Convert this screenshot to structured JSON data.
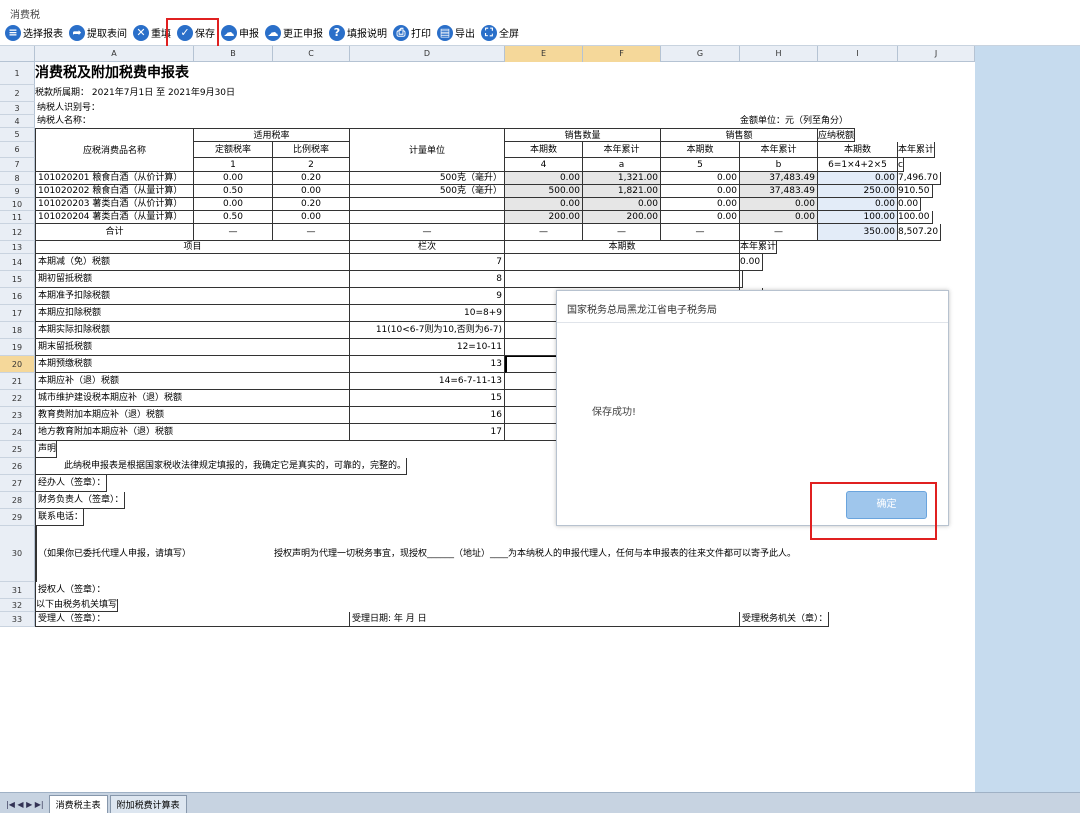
{
  "window": {
    "title": "消费税"
  },
  "toolbar": {
    "items": [
      {
        "label": "选择报表",
        "icon": "list-icon"
      },
      {
        "label": "提取表间",
        "icon": "arrow-icon"
      },
      {
        "label": "重填",
        "icon": "close-icon"
      },
      {
        "label": "保存",
        "icon": "check-icon"
      },
      {
        "label": "申报",
        "icon": "cloud-icon"
      },
      {
        "label": "更正申报",
        "icon": "cloud-icon"
      },
      {
        "label": "填报说明",
        "icon": "help-icon"
      },
      {
        "label": "打印",
        "icon": "printer-icon"
      },
      {
        "label": "导出",
        "icon": "document-icon"
      },
      {
        "label": "全屏",
        "icon": "fullscreen-icon"
      }
    ]
  },
  "columns": [
    "A",
    "B",
    "C",
    "D",
    "E",
    "F",
    "G",
    "H",
    "I",
    "J"
  ],
  "row_numbers": [
    "1",
    "2",
    "3",
    "4",
    "5",
    "6",
    "7",
    "8",
    "9",
    "10",
    "11",
    "12",
    "13",
    "14",
    "15",
    "16",
    "17",
    "18",
    "19",
    "20",
    "21",
    "22",
    "23",
    "24",
    "25",
    "26",
    "27",
    "28",
    "29",
    "30",
    "31",
    "32",
    "33"
  ],
  "form": {
    "title": "消费税及附加税费申报表",
    "period": "税款所属期： 2021年7月1日 至 2021年9月30日",
    "taxpayer_id": "纳税人识别号：",
    "taxpayer_name": "纳税人名称：",
    "unit": "金额单位：元（列至角分）",
    "h_name": "应税消费品名称",
    "h_rate": "适用税率",
    "h_unit": "计量单位",
    "h_qty": "销售数量",
    "h_amt": "销售额",
    "h_tax": "应纳税额",
    "h_fixed": "定额税率",
    "h_prop": "比例税率",
    "h_cur1": "本期数",
    "h_ytd1": "本年累计",
    "h_cur2": "本期数",
    "h_ytd2": "本年累计",
    "h_cur3": "本期数",
    "h_ytd3": "本年累计",
    "code_1": "1",
    "code_2": "2",
    "code_3": "3",
    "code_4": "4",
    "code_a": "a",
    "code_5": "5",
    "code_b": "b",
    "code_6": "6=1×4+2×5",
    "code_c": "c",
    "items": [
      {
        "name": "101020201 粮食白酒（从价计算）",
        "fixed": "0.00",
        "prop": "0.20",
        "unit": "500克（毫升）",
        "qty": "0.00",
        "qty_ytd": "1,321.00",
        "amt": "0.00",
        "amt_ytd": "37,483.49",
        "tax": "0.00",
        "tax_ytd": "7,496.70"
      },
      {
        "name": "101020202 粮食白酒（从量计算）",
        "fixed": "0.50",
        "prop": "0.00",
        "unit": "500克（毫升）",
        "qty": "500.00",
        "qty_ytd": "1,821.00",
        "amt": "0.00",
        "amt_ytd": "37,483.49",
        "tax": "250.00",
        "tax_ytd": "910.50"
      },
      {
        "name": "101020203 薯类白酒（从价计算）",
        "fixed": "0.00",
        "prop": "0.20",
        "unit": "",
        "qty": "0.00",
        "qty_ytd": "0.00",
        "amt": "0.00",
        "amt_ytd": "0.00",
        "tax": "0.00",
        "tax_ytd": "0.00"
      },
      {
        "name": "101020204 薯类白酒（从量计算）",
        "fixed": "0.50",
        "prop": "0.00",
        "unit": "",
        "qty": "200.00",
        "qty_ytd": "200.00",
        "amt": "0.00",
        "amt_ytd": "0.00",
        "tax": "100.00",
        "tax_ytd": "100.00"
      }
    ],
    "total": {
      "label": "合计",
      "dash": "—",
      "tax": "350.00",
      "tax_ytd": "8,507.20"
    },
    "h_item": "项目",
    "h_col": "栏次",
    "h_cur": "本期数",
    "h_ytd": "本年累计",
    "lines": [
      {
        "label": "本期减（免）税额",
        "col": "7",
        "ytd": "0.00"
      },
      {
        "label": "期初留抵税额",
        "col": "8",
        "ytd": ""
      },
      {
        "label": "本期准予扣除税额",
        "col": "9",
        "ytd": "0.00"
      },
      {
        "label": "本期应扣除税额",
        "col": "10=8+9",
        "ytd": ""
      },
      {
        "label": "本期实际扣除税额",
        "col": "11(10<6-7则为10,否则为6-7)",
        "ytd": "0.00"
      },
      {
        "label": "期末留抵税额",
        "col": "12=10-11",
        "ytd": ""
      },
      {
        "label": "本期预缴税额",
        "col": "13",
        "ytd": ""
      },
      {
        "label": "本期应补（退）税额",
        "col": "14=6-7-11-13",
        "ytd": "07.20"
      },
      {
        "label": "城市维护建设税本期应补（退）税额",
        "col": "15",
        "ytd": "12.68"
      },
      {
        "label": "教育费附加本期应补（退）税额",
        "col": "16",
        "ytd": "5.25"
      },
      {
        "label": "地方教育附加本期应补（退）税额",
        "col": "17",
        "ytd": "3.50"
      }
    ],
    "decl": "声明",
    "decl_text": "此纳税申报表是根据国家税收法律规定填报的，我确定它是真实的，可靠的，完整的。",
    "agent": "经办人（签章）：",
    "finance": "财务负责人（签章）：",
    "phone": "联系电话：",
    "proxy_left": "（如果你已委托代理人申报，请填写）",
    "proxy_text": "授权声明为代理一切税务事宜，现授权______（地址）____为本纳税人的申报代理人，任何与本申报表的往来文件都可以寄予此人。",
    "authorizer": "授权人（签章）：",
    "tax_office_fill": "以下由税务机关填写",
    "receiver": "受理人（签章）：",
    "recv_date": "受理日期:    年  月  日",
    "recv_office": "受理税务机关（章）："
  },
  "sheet_tabs": [
    "消费税主表",
    "附加税费计算表"
  ],
  "dialog": {
    "title": "国家税务总局黑龙江省电子税务局",
    "message": "保存成功!",
    "ok": "确定"
  }
}
